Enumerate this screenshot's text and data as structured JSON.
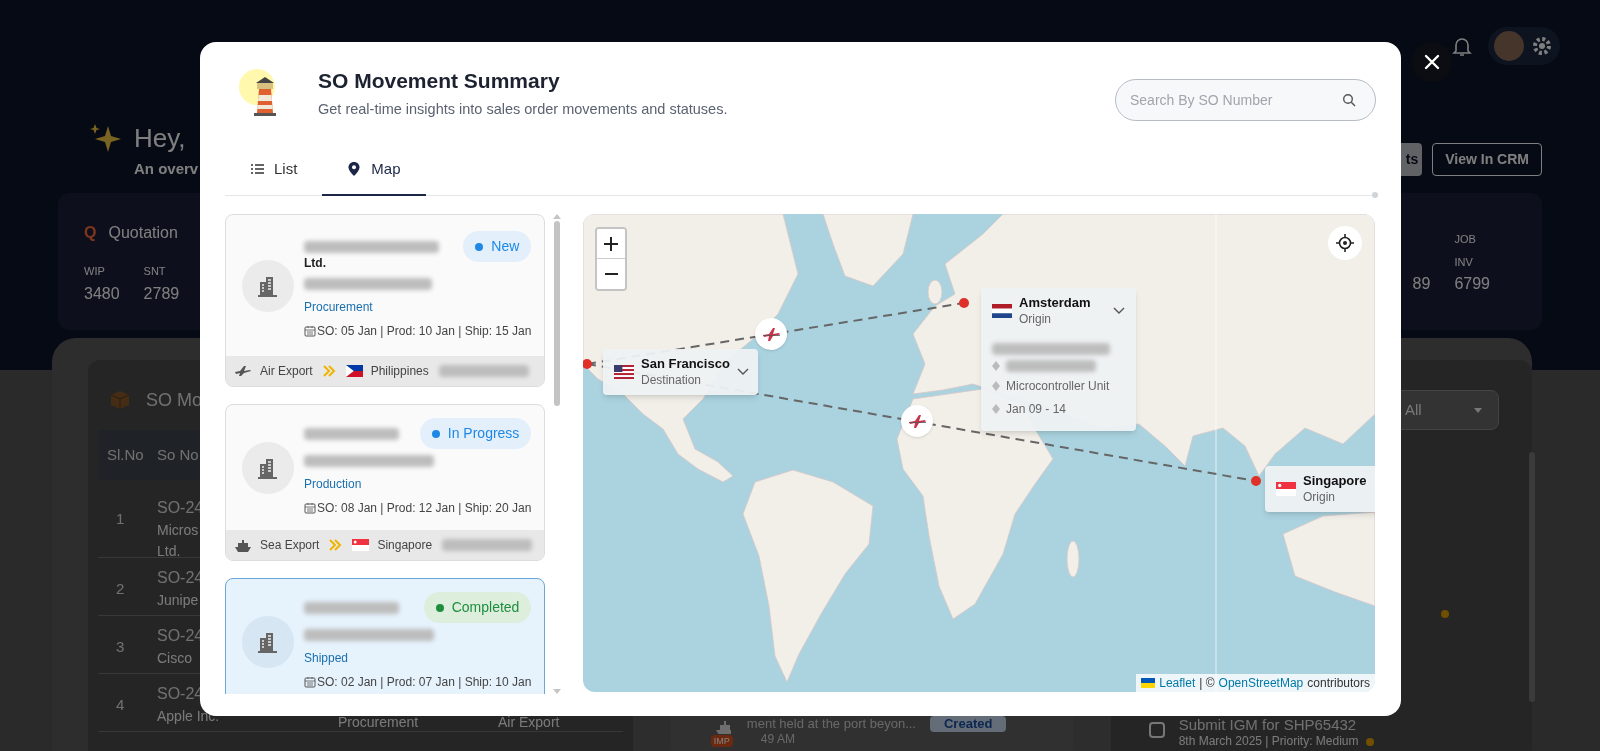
{
  "backdrop": {
    "greeting": "Hey,",
    "subtitle": "An overv",
    "header_buttons": [
      "ts",
      "View In CRM"
    ],
    "quotation": {
      "icon_letter": "Q",
      "title": "Quotation",
      "stats": [
        {
          "label": "WIP",
          "value": "3480"
        },
        {
          "label": "SNT",
          "value": "2789"
        }
      ]
    },
    "right_stats": [
      {
        "value": "89"
      },
      {
        "label": "JOB",
        "label_line2": "INV",
        "value": "6799"
      }
    ],
    "so_table": {
      "title": "SO Mo",
      "columns": [
        "Sl.No",
        "So No"
      ],
      "rows": [
        {
          "index": "1",
          "so": "SO-24",
          "customer": "Micros",
          "customer_line2": "Ltd."
        },
        {
          "index": "2",
          "so": "SO-24",
          "customer": "Junipe"
        },
        {
          "index": "3",
          "so": "SO-24",
          "customer": "Cisco"
        },
        {
          "index": "4",
          "so": "SO-24",
          "customer": "Apple Inc.",
          "stage": "Procurement",
          "mode": "Air Export"
        }
      ]
    },
    "filter": {
      "value": "All"
    },
    "activity": {
      "text": "ment held at the port beyon...",
      "badge": "Created",
      "time": "49 AM",
      "tag": "IMP"
    },
    "task": {
      "title": "Submit IGM for SHP65432",
      "meta": "8th March 2025 | Priority: Medium",
      "checked": false
    }
  },
  "modal": {
    "title": "SO Movement Summary",
    "subtitle": "Get real-time insights into sales order movements and statuses.",
    "search": {
      "placeholder": "Search By SO Number"
    },
    "tabs": [
      {
        "label": "List",
        "kind": "list",
        "selected": false
      },
      {
        "label": "Map",
        "kind": "map",
        "selected": true
      }
    ],
    "orders": [
      {
        "customer_line2": "Ltd.",
        "status": "New",
        "color": "#1e88e5",
        "stage": "Procurement",
        "dates": "SO: 05 Jan | Prod: 10 Jan | Ship: 15 Jan",
        "transport": {
          "kind": "air",
          "label": "Air Export"
        },
        "destination": {
          "kind": "ph",
          "country": "Philippines"
        },
        "selected": false
      },
      {
        "status": "In Progress",
        "color": "#1e88e5",
        "stage": "Production",
        "dates": "SO: 08 Jan | Prod: 12 Jan | Ship: 20 Jan",
        "transport": {
          "kind": "sea",
          "label": "Sea Export"
        },
        "destination": {
          "kind": "sg",
          "country": "Singapore"
        },
        "selected": false
      },
      {
        "status": "Completed",
        "color": "#1e8e3e",
        "stage": "Shipped",
        "dates": "SO: 02 Jan | Prod: 07 Jan | Ship: 10 Jan",
        "selected": true
      }
    ],
    "map": {
      "markers": [
        {
          "city": "San Francisco",
          "role": "Destination",
          "kind": "us",
          "expanded": false
        },
        {
          "city": "Amsterdam",
          "role": "Origin",
          "kind": "nl",
          "expanded": true,
          "details": [
            "Microcontroller Unit",
            "Jan 09 - 14"
          ]
        },
        {
          "city": "Singapore",
          "role": "Origin",
          "kind": "sg",
          "expanded": false
        }
      ],
      "attribution": {
        "leaflet": "Leaflet",
        "separator": "| ©",
        "osm": "OpenStreetMap",
        "rest": "contributors"
      }
    }
  }
}
